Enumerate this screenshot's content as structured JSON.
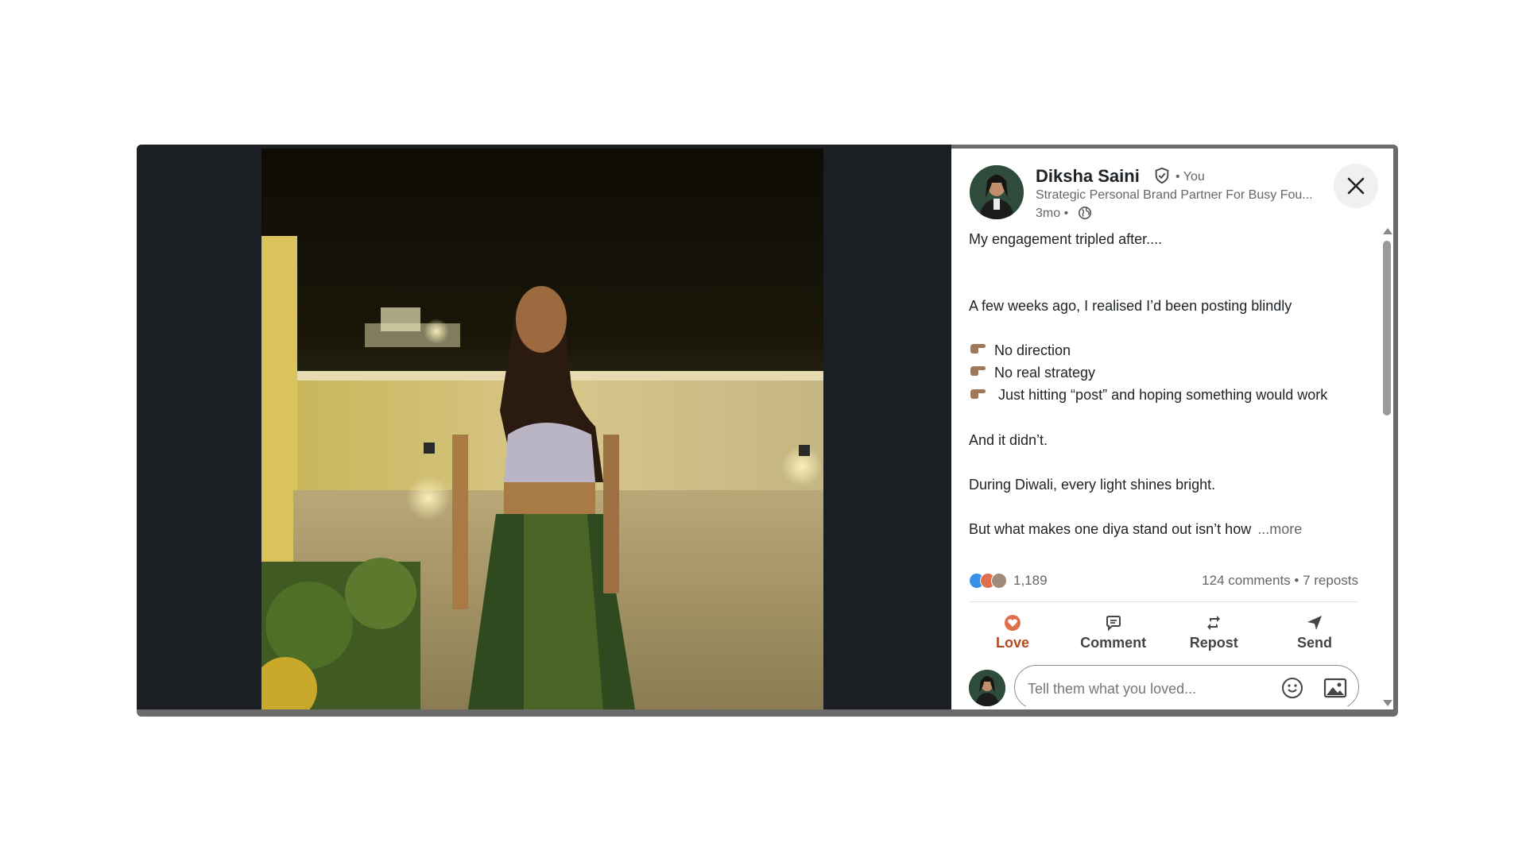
{
  "author": {
    "name": "Diksha Saini",
    "you_tag": "• You",
    "headline": "Strategic Personal Brand Partner For Busy Fou...",
    "time": "3mo •"
  },
  "post": {
    "line1": "My engagement tripled after....",
    "line2": "A few weeks ago, I realised I’d been posting blindly",
    "bullets": [
      "No direction",
      "No real strategy",
      "Just hitting “post” and hoping something would work"
    ],
    "line3": "And it didn’t.",
    "line4": "During Diwali, every light shines bright.",
    "line5": "But what makes one diya stand out isn’t how",
    "more": "...more"
  },
  "stats": {
    "reactions": "1,189",
    "comments_reposts": "124 comments • 7 reposts"
  },
  "actions": {
    "love": "Love",
    "comment": "Comment",
    "repost": "Repost",
    "send": "Send"
  },
  "comment_input": {
    "placeholder": "Tell them what you loved..."
  },
  "icons": {
    "verified": "verified-badge-icon",
    "globe": "globe-icon",
    "close": "close-icon",
    "love": "heart-icon",
    "comment": "speech-bubble-icon",
    "repost": "repost-arrows-icon",
    "send": "paper-plane-icon",
    "emoji": "smiley-icon",
    "image": "image-icon"
  },
  "colors": {
    "love_accent": "#b5481d",
    "like_blue": "#378fe9",
    "love_red": "#df704d"
  }
}
